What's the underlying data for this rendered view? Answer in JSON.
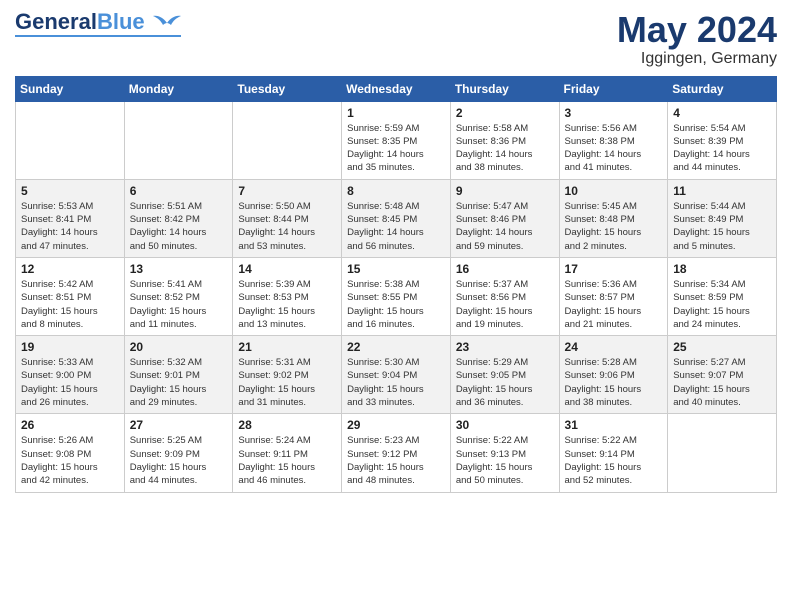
{
  "header": {
    "logo_general": "General",
    "logo_blue": "Blue",
    "month": "May 2024",
    "location": "Iggingen, Germany"
  },
  "weekdays": [
    "Sunday",
    "Monday",
    "Tuesday",
    "Wednesday",
    "Thursday",
    "Friday",
    "Saturday"
  ],
  "rows": [
    [
      {
        "num": "",
        "info": ""
      },
      {
        "num": "",
        "info": ""
      },
      {
        "num": "",
        "info": ""
      },
      {
        "num": "1",
        "info": "Sunrise: 5:59 AM\nSunset: 8:35 PM\nDaylight: 14 hours\nand 35 minutes."
      },
      {
        "num": "2",
        "info": "Sunrise: 5:58 AM\nSunset: 8:36 PM\nDaylight: 14 hours\nand 38 minutes."
      },
      {
        "num": "3",
        "info": "Sunrise: 5:56 AM\nSunset: 8:38 PM\nDaylight: 14 hours\nand 41 minutes."
      },
      {
        "num": "4",
        "info": "Sunrise: 5:54 AM\nSunset: 8:39 PM\nDaylight: 14 hours\nand 44 minutes."
      }
    ],
    [
      {
        "num": "5",
        "info": "Sunrise: 5:53 AM\nSunset: 8:41 PM\nDaylight: 14 hours\nand 47 minutes."
      },
      {
        "num": "6",
        "info": "Sunrise: 5:51 AM\nSunset: 8:42 PM\nDaylight: 14 hours\nand 50 minutes."
      },
      {
        "num": "7",
        "info": "Sunrise: 5:50 AM\nSunset: 8:44 PM\nDaylight: 14 hours\nand 53 minutes."
      },
      {
        "num": "8",
        "info": "Sunrise: 5:48 AM\nSunset: 8:45 PM\nDaylight: 14 hours\nand 56 minutes."
      },
      {
        "num": "9",
        "info": "Sunrise: 5:47 AM\nSunset: 8:46 PM\nDaylight: 14 hours\nand 59 minutes."
      },
      {
        "num": "10",
        "info": "Sunrise: 5:45 AM\nSunset: 8:48 PM\nDaylight: 15 hours\nand 2 minutes."
      },
      {
        "num": "11",
        "info": "Sunrise: 5:44 AM\nSunset: 8:49 PM\nDaylight: 15 hours\nand 5 minutes."
      }
    ],
    [
      {
        "num": "12",
        "info": "Sunrise: 5:42 AM\nSunset: 8:51 PM\nDaylight: 15 hours\nand 8 minutes."
      },
      {
        "num": "13",
        "info": "Sunrise: 5:41 AM\nSunset: 8:52 PM\nDaylight: 15 hours\nand 11 minutes."
      },
      {
        "num": "14",
        "info": "Sunrise: 5:39 AM\nSunset: 8:53 PM\nDaylight: 15 hours\nand 13 minutes."
      },
      {
        "num": "15",
        "info": "Sunrise: 5:38 AM\nSunset: 8:55 PM\nDaylight: 15 hours\nand 16 minutes."
      },
      {
        "num": "16",
        "info": "Sunrise: 5:37 AM\nSunset: 8:56 PM\nDaylight: 15 hours\nand 19 minutes."
      },
      {
        "num": "17",
        "info": "Sunrise: 5:36 AM\nSunset: 8:57 PM\nDaylight: 15 hours\nand 21 minutes."
      },
      {
        "num": "18",
        "info": "Sunrise: 5:34 AM\nSunset: 8:59 PM\nDaylight: 15 hours\nand 24 minutes."
      }
    ],
    [
      {
        "num": "19",
        "info": "Sunrise: 5:33 AM\nSunset: 9:00 PM\nDaylight: 15 hours\nand 26 minutes."
      },
      {
        "num": "20",
        "info": "Sunrise: 5:32 AM\nSunset: 9:01 PM\nDaylight: 15 hours\nand 29 minutes."
      },
      {
        "num": "21",
        "info": "Sunrise: 5:31 AM\nSunset: 9:02 PM\nDaylight: 15 hours\nand 31 minutes."
      },
      {
        "num": "22",
        "info": "Sunrise: 5:30 AM\nSunset: 9:04 PM\nDaylight: 15 hours\nand 33 minutes."
      },
      {
        "num": "23",
        "info": "Sunrise: 5:29 AM\nSunset: 9:05 PM\nDaylight: 15 hours\nand 36 minutes."
      },
      {
        "num": "24",
        "info": "Sunrise: 5:28 AM\nSunset: 9:06 PM\nDaylight: 15 hours\nand 38 minutes."
      },
      {
        "num": "25",
        "info": "Sunrise: 5:27 AM\nSunset: 9:07 PM\nDaylight: 15 hours\nand 40 minutes."
      }
    ],
    [
      {
        "num": "26",
        "info": "Sunrise: 5:26 AM\nSunset: 9:08 PM\nDaylight: 15 hours\nand 42 minutes."
      },
      {
        "num": "27",
        "info": "Sunrise: 5:25 AM\nSunset: 9:09 PM\nDaylight: 15 hours\nand 44 minutes."
      },
      {
        "num": "28",
        "info": "Sunrise: 5:24 AM\nSunset: 9:11 PM\nDaylight: 15 hours\nand 46 minutes."
      },
      {
        "num": "29",
        "info": "Sunrise: 5:23 AM\nSunset: 9:12 PM\nDaylight: 15 hours\nand 48 minutes."
      },
      {
        "num": "30",
        "info": "Sunrise: 5:22 AM\nSunset: 9:13 PM\nDaylight: 15 hours\nand 50 minutes."
      },
      {
        "num": "31",
        "info": "Sunrise: 5:22 AM\nSunset: 9:14 PM\nDaylight: 15 hours\nand 52 minutes."
      },
      {
        "num": "",
        "info": ""
      }
    ]
  ]
}
